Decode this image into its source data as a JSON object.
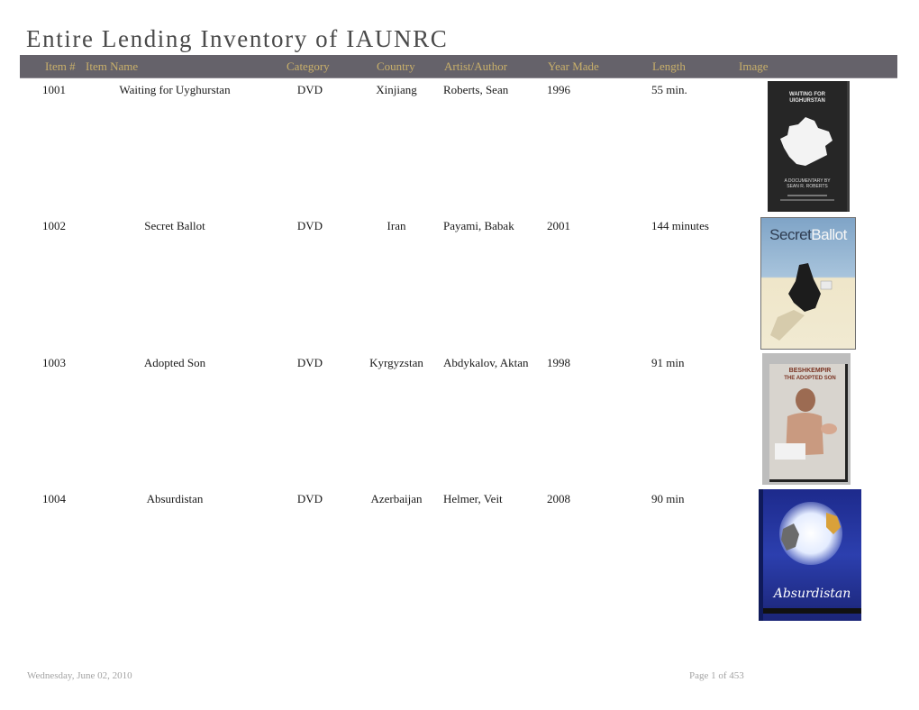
{
  "report": {
    "title": "Entire Lending Inventory of IAUNRC"
  },
  "columns": {
    "item_num": "Item #",
    "item_name": "Item Name",
    "category": "Category",
    "country": "Country",
    "artist": "Artist/Author",
    "year": "Year Made",
    "length": "Length",
    "image": "Image"
  },
  "rows": [
    {
      "item_num": "1001",
      "item_name": "Waiting for Uyghurstan",
      "category": "DVD",
      "country": "Xinjiang",
      "artist": "Roberts, Sean",
      "year": "1996",
      "length": "55 min.",
      "cover": {
        "line1": "WAITING FOR",
        "line2": "UIGHURSTAN",
        "line3": "A DOCUMENTARY BY",
        "line4": "SEAN R. ROBERTS"
      }
    },
    {
      "item_num": "1002",
      "item_name": "Secret Ballot",
      "category": "DVD",
      "country": "Iran",
      "artist": "Payami, Babak",
      "year": "2001",
      "length": "144 minutes",
      "cover": {
        "word1": "Secret",
        "word2": "Ballot"
      }
    },
    {
      "item_num": "1003",
      "item_name": "Adopted Son",
      "category": "DVD",
      "country": "Kyrgyzstan",
      "artist": "Abdykalov, Aktan",
      "year": "1998",
      "length": "91 min",
      "cover": {
        "line1": "BESHKEMPIR",
        "line2": "THE ADOPTED SON"
      }
    },
    {
      "item_num": "1004",
      "item_name": "Absurdistan",
      "category": "DVD",
      "country": "Azerbaijan",
      "artist": "Helmer, Veit",
      "year": "2008",
      "length": "90 min",
      "cover": {
        "title": "Absurdistan"
      }
    }
  ],
  "footer": {
    "date": "Wednesday, June 02, 2010",
    "page": "Page 1 of 453"
  }
}
